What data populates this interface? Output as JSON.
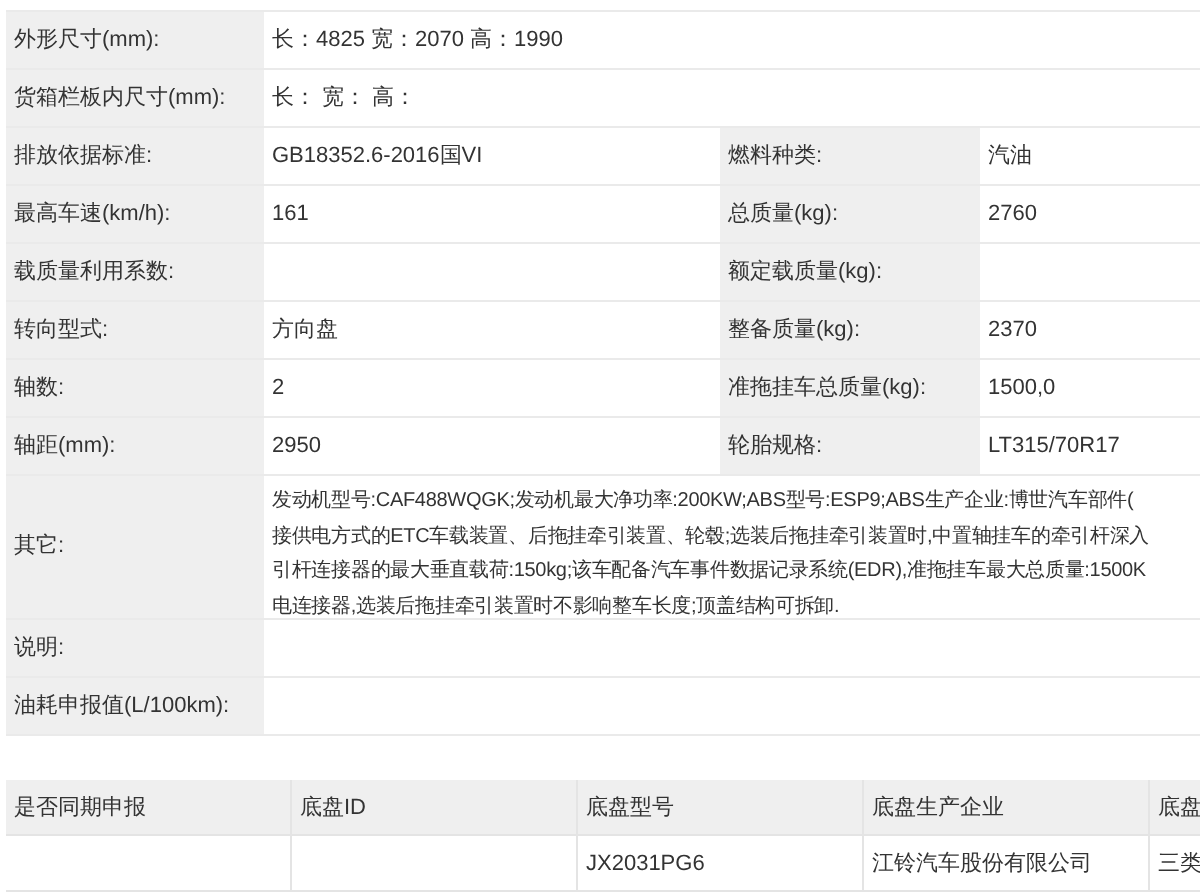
{
  "specs": [
    {
      "kind": "full",
      "label": "外形尺寸(mm):",
      "value": "长：4825 宽：2070 高：1990"
    },
    {
      "kind": "full",
      "label": "货箱栏板内尺寸(mm):",
      "value": "长：  宽：  高："
    },
    {
      "kind": "pair",
      "label": "排放依据标准:",
      "value": "GB18352.6-2016国VI",
      "label2": "燃料种类:",
      "value2": "汽油"
    },
    {
      "kind": "pair",
      "label": "最高车速(km/h):",
      "value": "161",
      "label2": "总质量(kg):",
      "value2": "2760"
    },
    {
      "kind": "pair",
      "label": "载质量利用系数:",
      "label2": "额定载质量(kg):"
    },
    {
      "kind": "pair",
      "label": "转向型式:",
      "value": "方向盘",
      "label2": "整备质量(kg):",
      "value2": "2370"
    },
    {
      "kind": "pair",
      "label": "轴数:",
      "value": "2",
      "label2": "准拖挂车总质量(kg):",
      "value2": "1500,0"
    },
    {
      "kind": "pair",
      "label": "轴距(mm):",
      "value": "2950",
      "label2": "轮胎规格:",
      "value2": "LT315/70R17"
    },
    {
      "kind": "lines",
      "label": "其它:",
      "lines": [
        "发动机型号:CAF488WQGK;发动机最大净功率:200KW;ABS型号:ESP9;ABS生产企业:博世汽车部件(",
        "接供电方式的ETC车载装置、后拖挂牵引装置、轮毂;选装后拖挂牵引装置时,中置轴挂车的牵引杆深入",
        "引杆连接器的最大垂直载荷:150kg;该车配备汽车事件数据记录系统(EDR),准拖挂车最大总质量:1500K",
        "电连接器,选装后拖挂牵引装置时不影响整车长度;顶盖结构可拆卸."
      ]
    },
    {
      "kind": "full",
      "label": "说明:"
    },
    {
      "kind": "full",
      "label": "油耗申报值(L/100km):"
    }
  ],
  "chassis": {
    "columns": [
      "是否同期申报",
      "底盘ID",
      "底盘型号",
      "底盘生产企业",
      "底盘"
    ],
    "rows": [
      [
        "",
        "",
        "JX2031PG6",
        "江铃汽车股份有限公司",
        "三类"
      ]
    ]
  }
}
